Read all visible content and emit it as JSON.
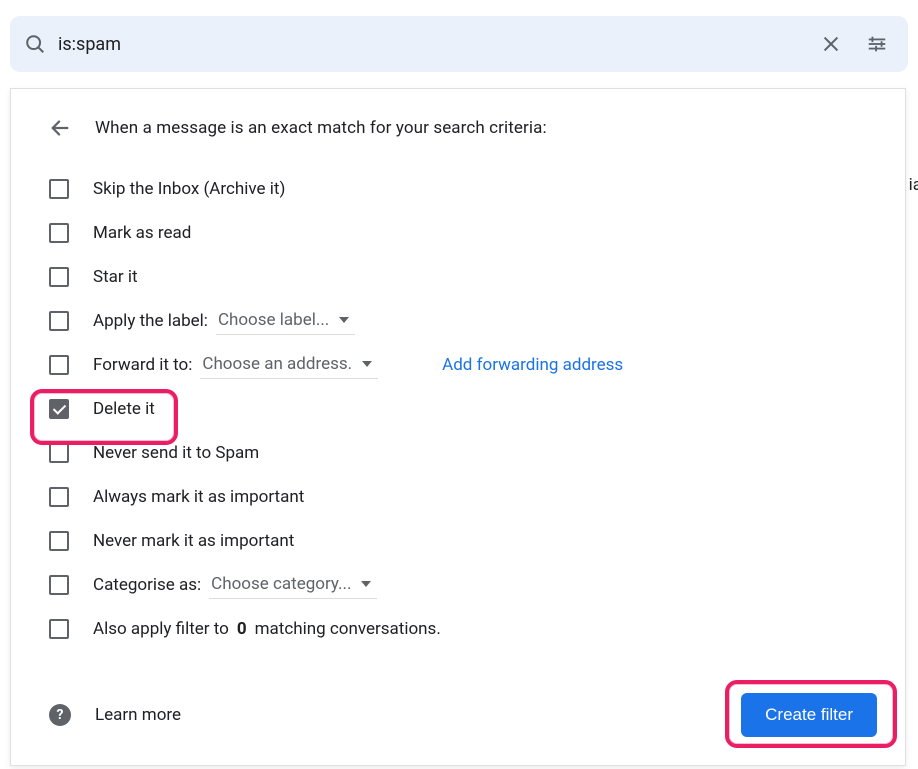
{
  "search": {
    "query": "is:spam"
  },
  "filter": {
    "header": "When a message is an exact match for your search criteria:",
    "options": {
      "skip_inbox": {
        "label": "Skip the Inbox (Archive it)",
        "checked": false
      },
      "mark_read": {
        "label": "Mark as read",
        "checked": false
      },
      "star_it": {
        "label": "Star it",
        "checked": false
      },
      "apply_label": {
        "label": "Apply the label:",
        "dropdown": "Choose label...",
        "checked": false
      },
      "forward_it": {
        "label": "Forward it to:",
        "dropdown": "Choose an address.",
        "checked": false
      },
      "delete_it": {
        "label": "Delete it",
        "checked": true
      },
      "never_spam": {
        "label": "Never send it to Spam",
        "checked": false
      },
      "always_important": {
        "label": "Always mark it as important",
        "checked": false
      },
      "never_important": {
        "label": "Never mark it as important",
        "checked": false
      },
      "categorise": {
        "label": "Categorise as:",
        "dropdown": "Choose category...",
        "checked": false
      },
      "also_apply_prefix": "Also apply filter to ",
      "also_apply_count": "0",
      "also_apply_suffix": " matching conversations."
    },
    "forwarding_link": "Add forwarding address",
    "learn_more": "Learn more",
    "create_button": "Create filter"
  },
  "overflow_text": "ia"
}
